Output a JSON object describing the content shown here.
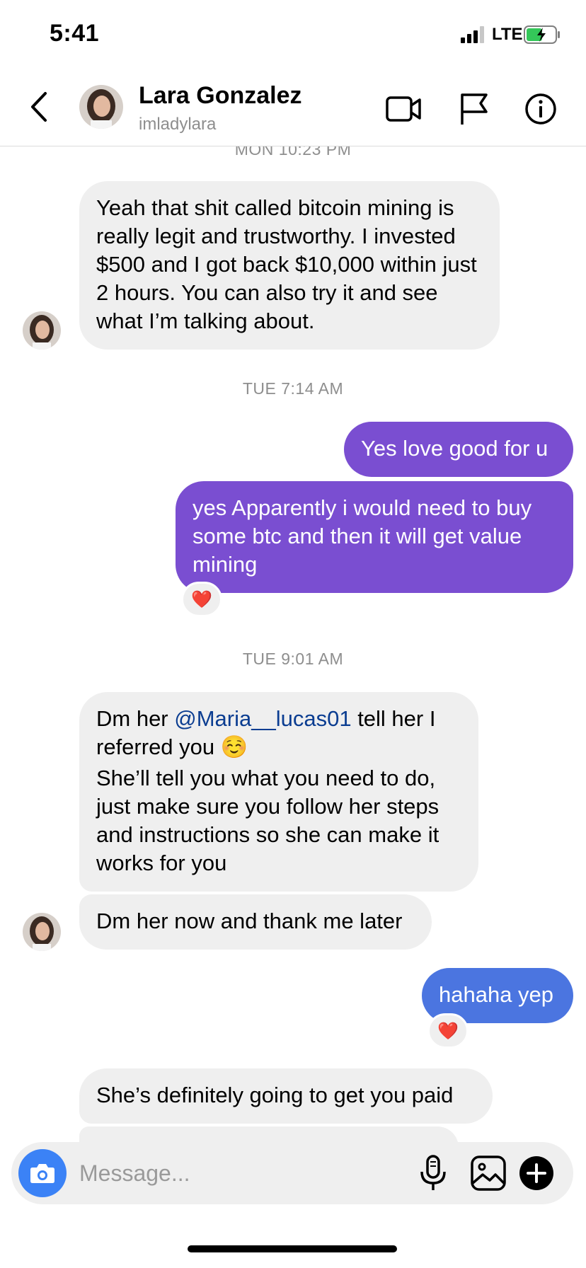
{
  "status_bar": {
    "time": "5:41",
    "network": "LTE"
  },
  "header": {
    "name": "Lara Gonzalez",
    "handle": "imladylara"
  },
  "timestamps": {
    "mon": "MON 10:23 PM",
    "tue1": "TUE 7:14 AM",
    "tue2": "TUE 9:01 AM"
  },
  "messages": {
    "m1": "Yeah that shit called bitcoin mining is really legit and trustworthy. I invested $500 and I got back $10,000 within just 2 hours. You can also try it and see what I’m talking about.",
    "m2": "Yes love good for u",
    "m3": "yes Apparently i would need to buy some btc and then it will get value mining",
    "m4_pre": "Dm her ",
    "m4_mention": "@Maria__lucas01",
    "m4_post": " tell her I referred you ☺️",
    "m4_rest": "She’ll tell you what you need to do, just make sure you follow her steps and instructions so she can make it works for you",
    "m5": "Dm her now and thank me later",
    "m6": "hahaha yep",
    "m7": "She’s definitely going to get you paid"
  },
  "reactions": {
    "r1": "❤️",
    "r2": "❤️"
  },
  "composer": {
    "placeholder": "Message..."
  },
  "colors": {
    "outgoing_purple": "#7a4ed1",
    "outgoing_blue": "#4b75e0",
    "incoming": "#efefef",
    "camera": "#3b82f6"
  },
  "icons": [
    "back-icon",
    "video-call-icon",
    "flag-icon",
    "info-icon",
    "camera-icon",
    "microphone-icon",
    "gallery-icon",
    "plus-icon"
  ]
}
